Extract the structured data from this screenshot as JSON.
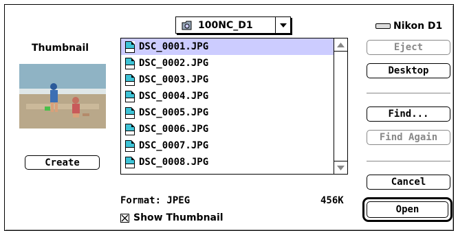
{
  "popup": {
    "folder_name": "100NC_D1",
    "folder_icon": "folder-icon",
    "arrow_icon": "chevron-down-icon"
  },
  "thumbnail": {
    "title": "Thumbnail",
    "create_label": "Create"
  },
  "files": [
    {
      "name": "DSC_0001.JPG",
      "selected": true
    },
    {
      "name": "DSC_0002.JPG",
      "selected": false
    },
    {
      "name": "DSC_0003.JPG",
      "selected": false
    },
    {
      "name": "DSC_0004.JPG",
      "selected": false
    },
    {
      "name": "DSC_0005.JPG",
      "selected": false
    },
    {
      "name": "DSC_0006.JPG",
      "selected": false
    },
    {
      "name": "DSC_0007.JPG",
      "selected": false
    },
    {
      "name": "DSC_0008.JPG",
      "selected": false
    }
  ],
  "status": {
    "format": "Format: JPEG",
    "size": "456K",
    "show_thumbnail": "Show Thumbnail",
    "show_thumbnail_checked": true
  },
  "drive": {
    "name": "Nikon D1",
    "icon": "hard-drive-icon"
  },
  "buttons": {
    "eject": "Eject",
    "desktop": "Desktop",
    "find": "Find...",
    "find_again": "Find Again",
    "cancel": "Cancel",
    "open": "Open"
  },
  "colors": {
    "selection": "#ccccff",
    "jpeg_icon": "#3ec3d6",
    "disabled": "#888888"
  }
}
